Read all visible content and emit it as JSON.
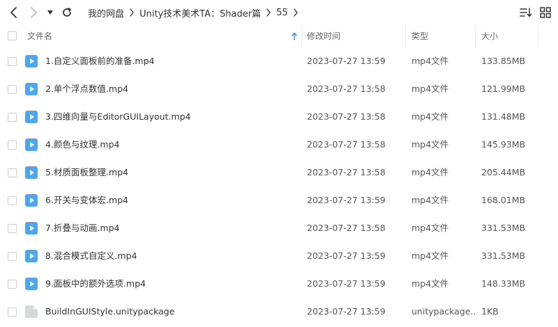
{
  "toolbar": {
    "back_icon": "chevron-left-icon",
    "forward_icon": "chevron-right-icon",
    "history_icon": "caret-down-icon",
    "refresh_icon": "refresh-icon",
    "sort_icon": "sort-list-icon",
    "view_icon": "grid-view-icon"
  },
  "breadcrumb": {
    "items": [
      "我的网盘",
      "Unity技术美术TA：Shader篇",
      "55"
    ]
  },
  "columns": {
    "name": "文件名",
    "modified": "修改时间",
    "type": "类型",
    "size": "大小"
  },
  "colors": {
    "video_icon": "#4ea6ee",
    "package_icon": "#d5d8dc",
    "sort_arrow": "#3b8cf0"
  },
  "files": [
    {
      "name": "1.自定义面板前的准备.mp4",
      "modified": "2023-07-27 13:59",
      "type": "mp4文件",
      "size": "133.85MB",
      "icon": "video-file-icon"
    },
    {
      "name": "2.单个浮点数值.mp4",
      "modified": "2023-07-27 13:58",
      "type": "mp4文件",
      "size": "121.99MB",
      "icon": "video-file-icon"
    },
    {
      "name": "3.四维向量与EditorGUILayout.mp4",
      "modified": "2023-07-27 13:58",
      "type": "mp4文件",
      "size": "131.48MB",
      "icon": "video-file-icon"
    },
    {
      "name": "4.颜色与纹理.mp4",
      "modified": "2023-07-27 13:58",
      "type": "mp4文件",
      "size": "145.93MB",
      "icon": "video-file-icon"
    },
    {
      "name": "5.材质面板整理.mp4",
      "modified": "2023-07-27 13:58",
      "type": "mp4文件",
      "size": "205.44MB",
      "icon": "video-file-icon"
    },
    {
      "name": "6.开关与变体宏.mp4",
      "modified": "2023-07-27 13:59",
      "type": "mp4文件",
      "size": "168.01MB",
      "icon": "video-file-icon"
    },
    {
      "name": "7.折叠与动画.mp4",
      "modified": "2023-07-27 13:58",
      "type": "mp4文件",
      "size": "331.53MB",
      "icon": "video-file-icon"
    },
    {
      "name": "8.混合模式自定义.mp4",
      "modified": "2023-07-27 13:59",
      "type": "mp4文件",
      "size": "331.53MB",
      "icon": "video-file-icon"
    },
    {
      "name": "9.面板中的额外选项.mp4",
      "modified": "2023-07-27 13:59",
      "type": "mp4文件",
      "size": "148.33MB",
      "icon": "video-file-icon"
    },
    {
      "name": "BuildInGUIStyle.unitypackage",
      "modified": "2023-07-27 13:59",
      "type": "unitypackage...",
      "size": "1KB",
      "icon": "package-file-icon"
    }
  ]
}
